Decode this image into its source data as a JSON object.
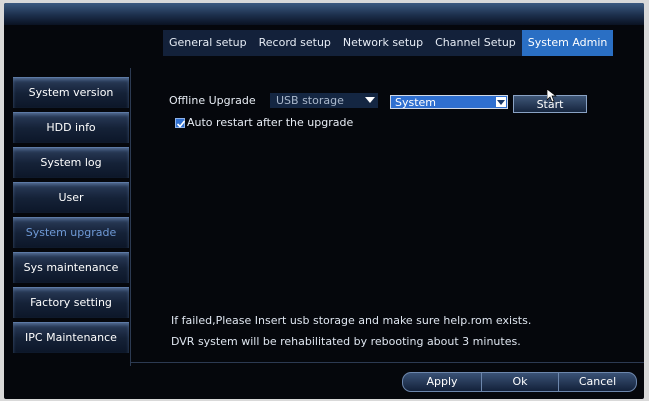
{
  "tabs": [
    {
      "label": "General setup"
    },
    {
      "label": "Record setup"
    },
    {
      "label": "Network setup"
    },
    {
      "label": "Channel Setup"
    },
    {
      "label": "System Admin"
    }
  ],
  "sidebar": {
    "items": [
      {
        "label": "System version"
      },
      {
        "label": "HDD info"
      },
      {
        "label": "System log"
      },
      {
        "label": "User"
      },
      {
        "label": "System upgrade"
      },
      {
        "label": "Sys maintenance"
      },
      {
        "label": "Factory setting"
      },
      {
        "label": "IPC Maintenance"
      }
    ]
  },
  "upgrade": {
    "label": "Offline Upgrade",
    "storage_value": "USB storage",
    "target_value": "System",
    "start_label": "Start",
    "auto_restart_label": "Auto restart after the upgrade",
    "auto_restart_checked": true
  },
  "notes": {
    "line1": "If failed,Please Insert usb storage and make sure help.rom exists.",
    "line2": "DVR system will be rehabilitated by rebooting about 3 minutes."
  },
  "buttons": {
    "apply": "Apply",
    "ok": "Ok",
    "cancel": "Cancel"
  },
  "colors": {
    "active_tab": "#2a6fc4",
    "active_sidebar_text": "#6f9ad6",
    "select_highlight": "#2f6fd0"
  }
}
